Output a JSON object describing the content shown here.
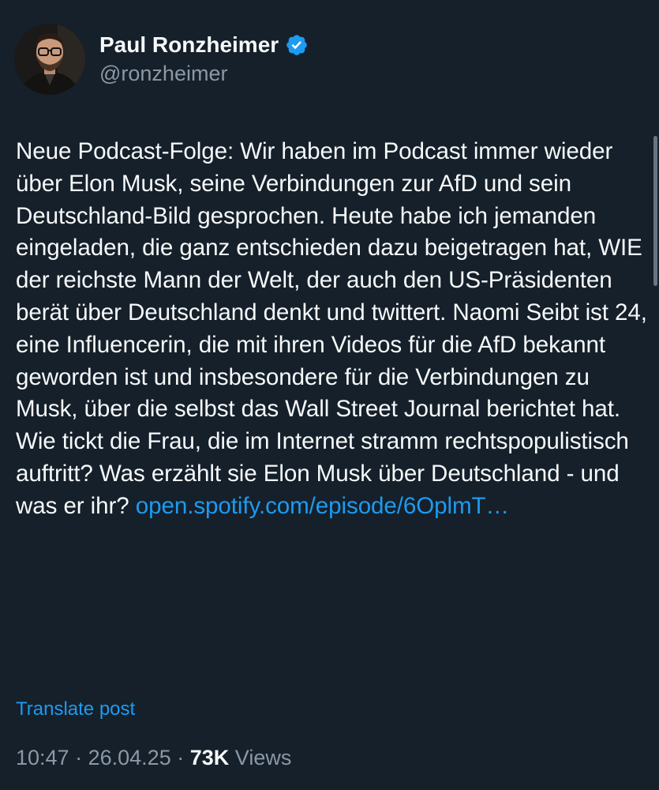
{
  "author": {
    "display_name": "Paul Ronzheimer",
    "handle": "@ronzheimer",
    "verified": true,
    "verified_color": "#1d9bf0"
  },
  "post": {
    "text": "Neue Podcast-Folge: Wir haben im Podcast immer wieder über Elon Musk, seine Verbindungen zur AfD und sein Deutschland-Bild gesprochen. Heute habe ich jemanden eingeladen, die ganz entschieden dazu beigetragen hat, WIE der reichste Mann der Welt, der auch den US-Präsidenten berät über Deutschland denkt und twittert. Naomi Seibt ist 24, eine Influencerin, die mit ihren Videos für die AfD bekannt geworden ist und insbesondere für die Verbindungen zu Musk, über die selbst das Wall Street Journal berichtet hat. Wie tickt die Frau, die im Internet stramm rechtspopulistisch auftritt? Was erzählt sie Elon Musk über Deutschland - und was er ihr?",
    "link_text": "open.spotify.com/episode/6OplmT…",
    "translate_label": "Translate post"
  },
  "meta": {
    "time": "10:47",
    "date": "26.04.25",
    "views_count": "73K",
    "views_label": "Views",
    "separator": "·"
  },
  "colors": {
    "background": "#15202b",
    "text": "#f7f9f9",
    "secondary": "#8b98a5",
    "accent": "#1d9bf0"
  }
}
